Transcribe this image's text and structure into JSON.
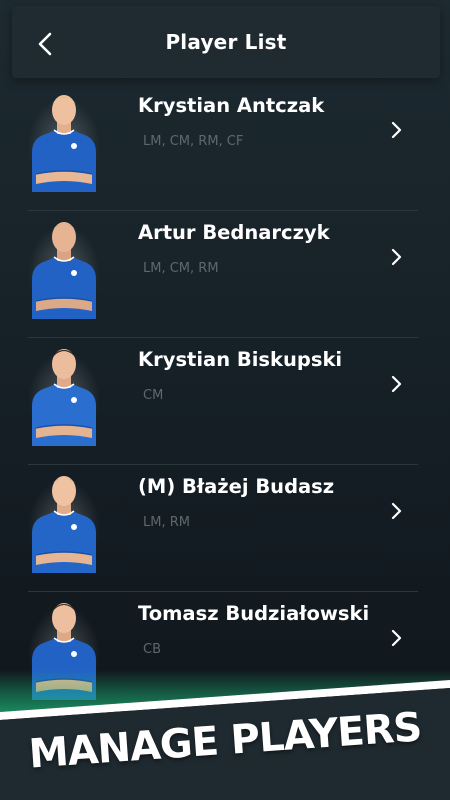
{
  "header": {
    "title": "Player List",
    "back_icon": "chevron-left-icon"
  },
  "players": [
    {
      "name": "Krystian Antczak",
      "positions": "LM, CM, RM, CF"
    },
    {
      "name": "Artur Bednarczyk",
      "positions": "LM, CM, RM"
    },
    {
      "name": "Krystian Biskupski",
      "positions": "CM"
    },
    {
      "name": "(M) Błażej Budasz",
      "positions": "LM, RM"
    },
    {
      "name": "Tomasz Budziałowski",
      "positions": "CB"
    }
  ],
  "banner": {
    "text": "MANAGE PLAYERS",
    "accent": "#1db87a"
  },
  "colors": {
    "background": "#141a1f",
    "header": "#1f2b31",
    "jersey": "#2262c5",
    "secondary_text": "#5d686e"
  }
}
